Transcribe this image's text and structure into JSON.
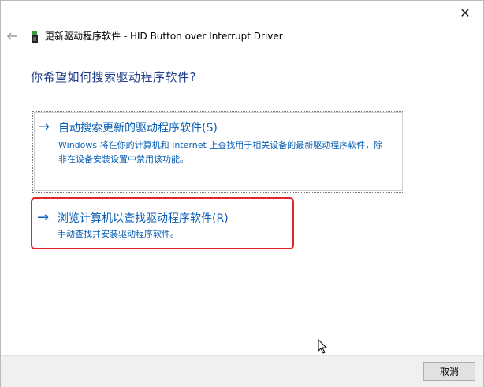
{
  "window": {
    "title": "更新驱动程序软件 - HID Button over Interrupt Driver",
    "close_label": "✕",
    "back_icon": "back-arrow-icon",
    "device_icon": "device-icon"
  },
  "main": {
    "heading": "你希望如何搜索驱动程序软件?",
    "options": [
      {
        "arrow": "→",
        "title": "自动搜索更新的驱动程序软件(S)",
        "description": "Windows 将在你的计算机和 Internet 上查找用于相关设备的最新驱动程序软件，除非在设备安装设置中禁用该功能。"
      },
      {
        "arrow": "→",
        "title": "浏览计算机以查找驱动程序软件(R)",
        "description": "手动查找并安装驱动程序软件。"
      }
    ]
  },
  "footer": {
    "cancel_label": "取消"
  },
  "colors": {
    "link_blue": "#0a5fb4",
    "heading_blue": "#1f3c88",
    "highlight_red": "#e0262b"
  }
}
